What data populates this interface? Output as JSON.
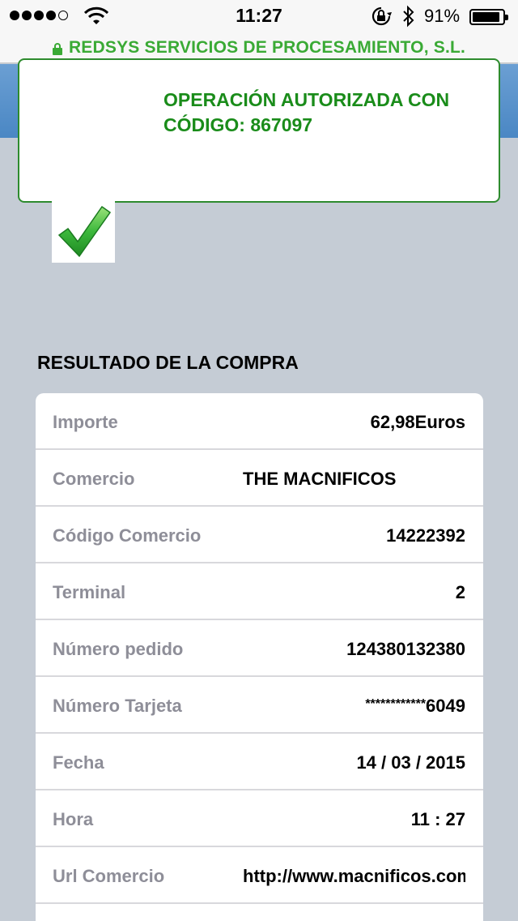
{
  "status_bar": {
    "time": "11:27",
    "battery": "91%",
    "battery_level": 0.91,
    "signal_bars_filled": 4,
    "signal_bars_total": 5
  },
  "url_bar": {
    "site_name": "REDSYS SERVICIOS DE PROCESAMIENTO, S.L.",
    "secure_color": "#3aaa35"
  },
  "auth": {
    "message": "OPERACIÓN AUTORIZADA CON CÓDIGO:  867097",
    "color": "#1a8c1a",
    "icon": "checkmark-icon"
  },
  "result": {
    "title": "RESULTADO DE LA COMPRA",
    "rows": [
      {
        "label": "Importe",
        "value": "62,98Euros"
      },
      {
        "label": "Comercio",
        "value": "THE MACNIFICOS"
      },
      {
        "label": "Código Comercio",
        "value": "14222392"
      },
      {
        "label": "Terminal",
        "value": "2"
      },
      {
        "label": "Número pedido",
        "value": "124380132380"
      },
      {
        "label": "Número Tarjeta",
        "value_stars": "************",
        "value_digits": "6049"
      },
      {
        "label": "Fecha",
        "value": "14 / 03 / 2015"
      },
      {
        "label": "Hora",
        "value": "11 : 27"
      },
      {
        "label": "Url Comercio",
        "value": "http://www.macnificos.com"
      }
    ]
  }
}
